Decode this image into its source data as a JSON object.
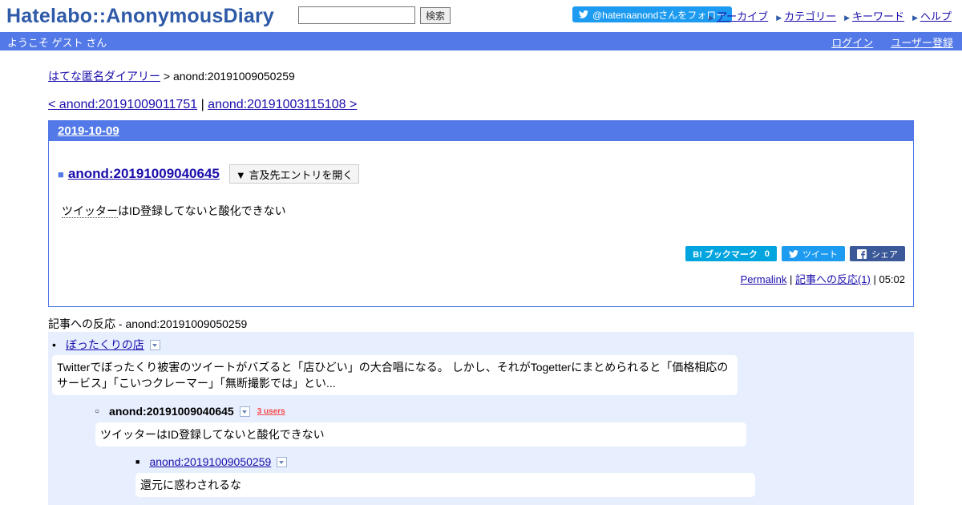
{
  "header": {
    "logo": "Hatelabo::AnonymousDiary",
    "search_placeholder": "",
    "search_label": "検索",
    "follow_label": "@hatenaanondさんをフォロー",
    "nav": [
      "アーカイブ",
      "カテゴリー",
      "キーワード",
      "ヘルプ"
    ]
  },
  "userbar": {
    "welcome": "ようこそ ゲスト さん",
    "login": "ログイン",
    "register": "ユーザー登録"
  },
  "breadcrumb": {
    "home": "はてな匿名ダイアリー",
    "sep": " > ",
    "current": "anond:20191009050259"
  },
  "pager": {
    "prev": "< anond:20191009011751",
    "sep": " | ",
    "next": "anond:20191003115108 >"
  },
  "entry": {
    "date": "2019-10-09",
    "title_mark": "■",
    "title": "anond:20191009040645",
    "open_button": "▼ 言及先エントリを開く",
    "body_prefix": "ツイッター",
    "body_rest": "はID登録してないと酸化できない",
    "bookmark_label": "B! ブックマーク",
    "bookmark_count": "0",
    "tweet_label": "ツイート",
    "share_label": "シェア",
    "permalink": "Permalink",
    "foot_sep": " | ",
    "reactions_link": "記事への反応(1)",
    "time": " | 05:02"
  },
  "reactions": {
    "heading": "記事への反応 - anond:20191009050259",
    "items": [
      {
        "title": "ぼったくりの店",
        "text": "Twitterでぼったくり被害のツイートがバズると「店ひどい」の大合唱になる。 しかし、それがTogetterにまとめられると「価格相応のサービス」「こいつクレーマー」「無断撮影では」とい..."
      },
      {
        "title": "anond:20191009040645",
        "users": "3 users",
        "text": "ツイッターはID登録してないと酸化できない"
      },
      {
        "title": "anond:20191009050259",
        "text": "還元に惑わされるな"
      }
    ]
  }
}
